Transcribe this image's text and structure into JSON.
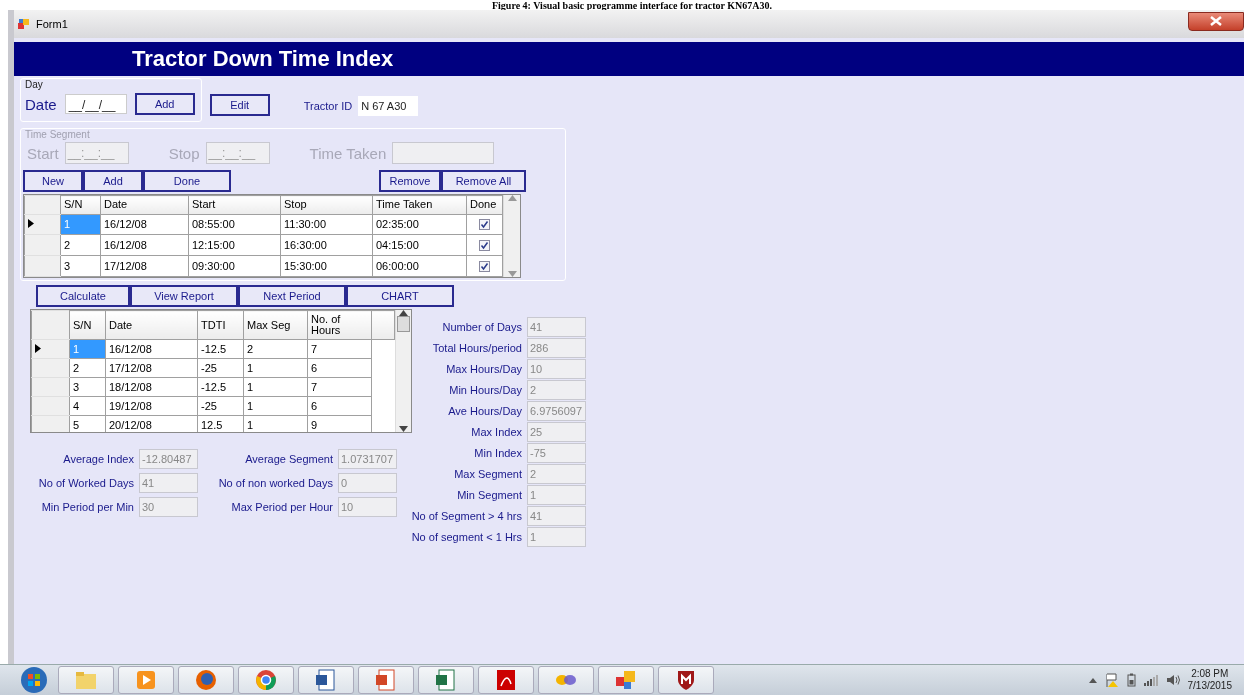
{
  "caption": "Figure 4: Visual basic programme interface for tractor KN67A30.",
  "window": {
    "title": "Form1"
  },
  "header": "Tractor Down Time Index",
  "day_group": {
    "legend": "Day",
    "date_label": "Date",
    "date_field": "__/__/__",
    "add_button": "Add"
  },
  "edit_button": "Edit",
  "tractor_id": {
    "label": "Tractor ID",
    "value": "N 67 A30"
  },
  "time_segment": {
    "legend": "Time Segment",
    "disabled": true,
    "fields": [
      {
        "label": "Start",
        "value": "__:__:__"
      },
      {
        "label": "Stop",
        "value": "__:__:__"
      },
      {
        "label": "Time Taken"
      }
    ],
    "left_buttons": [
      "New",
      "Add",
      "Done"
    ],
    "right_buttons": [
      "Remove",
      "Remove All"
    ]
  },
  "segments_table": {
    "columns": [
      "S/N",
      "Date",
      "Start",
      "Stop",
      "Time Taken",
      "Done"
    ],
    "rows": [
      {
        "selected": true,
        "cells": [
          "1",
          "16/12/08",
          "08:55:00",
          "11:30:00",
          "02:35:00"
        ],
        "done": true
      },
      {
        "selected": false,
        "cells": [
          "2",
          "16/12/08",
          "12:15:00",
          "16:30:00",
          "04:15:00"
        ],
        "done": true
      },
      {
        "selected": false,
        "cells": [
          "3",
          "17/12/08",
          "09:30:00",
          "15:30:00",
          "06:00:00"
        ],
        "done": true
      }
    ]
  },
  "action_buttons": [
    "Calculate",
    "View Report",
    "Next Period",
    "CHART"
  ],
  "index_table": {
    "columns": [
      "S/N",
      "Date",
      "TDTI",
      "Max Seg",
      "No. of Hours"
    ],
    "rows": [
      {
        "selected": true,
        "cells": [
          "1",
          "16/12/08",
          "-12.5",
          "2",
          "7"
        ]
      },
      {
        "selected": false,
        "cells": [
          "2",
          "17/12/08",
          "-25",
          "1",
          "6"
        ]
      },
      {
        "selected": false,
        "cells": [
          "3",
          "18/12/08",
          "-12.5",
          "1",
          "7"
        ]
      },
      {
        "selected": false,
        "cells": [
          "4",
          "19/12/08",
          "-25",
          "1",
          "6"
        ]
      },
      {
        "selected": false,
        "cells": [
          "5",
          "20/12/08",
          "12.5",
          "1",
          "9"
        ]
      }
    ]
  },
  "summary_left": [
    {
      "label": "Average Index",
      "value": "-12.80487"
    },
    {
      "label": "Average Segment",
      "value": "1.0731707"
    },
    {
      "label": "No of Worked Days",
      "value": "41"
    },
    {
      "label": "No of non worked Days",
      "value": "0"
    },
    {
      "label": "Min Period per Min",
      "value": "30"
    },
    {
      "label": "Max Period per Hour",
      "value": "10"
    }
  ],
  "summary_right": [
    {
      "label": "Number of Days",
      "value": "41"
    },
    {
      "label": "Total Hours/period",
      "value": "286"
    },
    {
      "label": "Max Hours/Day",
      "value": "10"
    },
    {
      "label": "Min Hours/Day",
      "value": "2"
    },
    {
      "label": "Ave Hours/Day",
      "value": "6.9756097"
    },
    {
      "label": "Max Index",
      "value": "25"
    },
    {
      "label": "Min Index",
      "value": "-75"
    },
    {
      "label": "Max Segment",
      "value": "2"
    },
    {
      "label": "Min Segment",
      "value": "1"
    },
    {
      "label": "No of Segment > 4 hrs",
      "value": "41"
    },
    {
      "label": "No of segment < 1 Hrs",
      "value": "1"
    }
  ],
  "taskbar": {
    "time": "2:08 PM",
    "date": "7/13/2015"
  }
}
